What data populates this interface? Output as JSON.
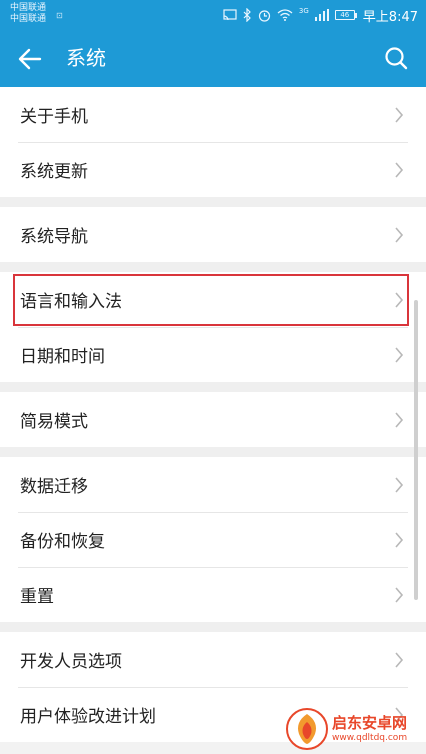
{
  "status": {
    "carrier_line1": "中国联通",
    "carrier_line2": "中国联通",
    "network": "3G",
    "battery": "46",
    "clock": "早上8:47"
  },
  "appbar": {
    "title": "系统"
  },
  "groups": [
    {
      "items": [
        {
          "label": "关于手机"
        },
        {
          "label": "系统更新"
        }
      ]
    },
    {
      "items": [
        {
          "label": "系统导航"
        }
      ]
    },
    {
      "items": [
        {
          "label": "语言和输入法"
        },
        {
          "label": "日期和时间"
        }
      ]
    },
    {
      "items": [
        {
          "label": "简易模式"
        }
      ]
    },
    {
      "items": [
        {
          "label": "数据迁移"
        },
        {
          "label": "备份和恢复"
        },
        {
          "label": "重置"
        }
      ]
    },
    {
      "items": [
        {
          "label": "开发人员选项"
        },
        {
          "label": "用户体验改进计划"
        }
      ]
    }
  ],
  "watermark": {
    "name": "启东安卓网",
    "url": "www.qdltdq.com"
  },
  "colors": {
    "accent": "#1e9ad6",
    "highlight": "#d9353b"
  }
}
